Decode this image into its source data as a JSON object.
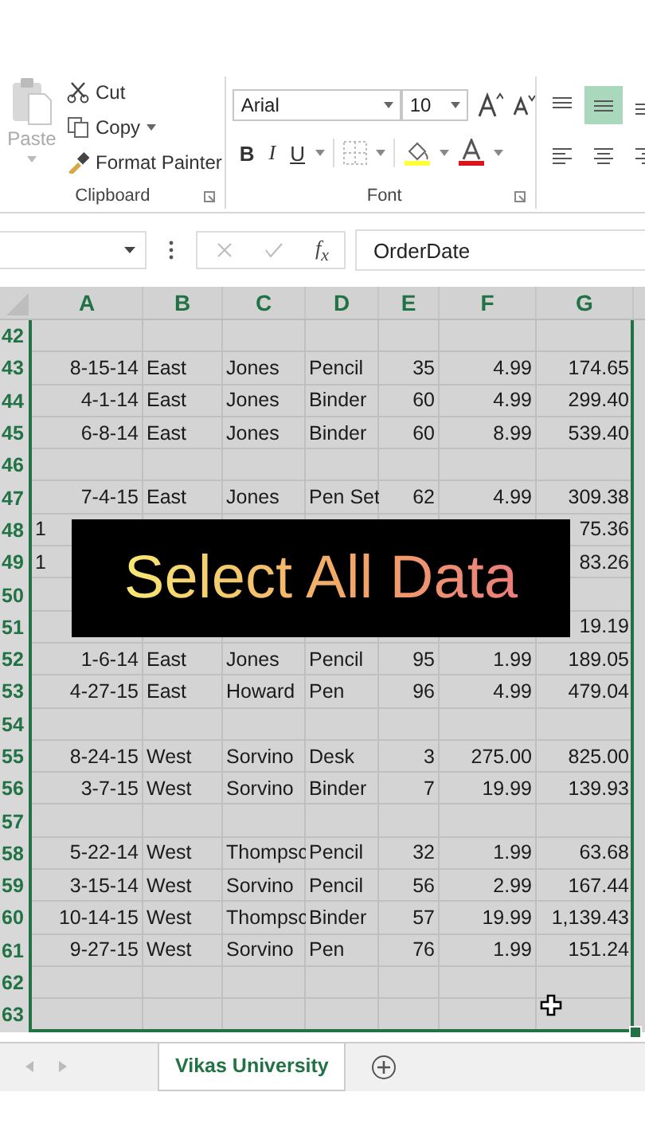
{
  "ribbon": {
    "clipboard": {
      "paste": {
        "label": "Paste",
        "disabled": true
      },
      "cut": "Cut",
      "copy": "Copy",
      "format_painter": "Format Painter",
      "group_label": "Clipboard"
    },
    "font": {
      "font_name": "Arial",
      "font_size": "10",
      "bold": "B",
      "italic": "I",
      "underline": "U",
      "group_label": "Font"
    },
    "alignment": {
      "top_buttons": [
        {
          "kind": "top",
          "selected": false
        },
        {
          "kind": "middle",
          "selected": true
        },
        {
          "kind": "bottom",
          "selected": false
        }
      ],
      "bottom_buttons": [
        {
          "kind": "left",
          "selected": false
        },
        {
          "kind": "center",
          "selected": false
        },
        {
          "kind": "right",
          "selected": false
        }
      ]
    }
  },
  "formula_bar": {
    "function_symbol": "f$_{x}$",
    "formula": "OrderDate"
  },
  "columns": [
    {
      "label": "A",
      "selected": true
    },
    {
      "label": "B",
      "selected": true
    },
    {
      "label": "C",
      "selected": true
    },
    {
      "label": "D",
      "selected": true
    },
    {
      "label": "E",
      "selected": true
    },
    {
      "label": "F",
      "selected": true
    },
    {
      "label": "G",
      "selected": true
    }
  ],
  "rows": [
    {
      "header": "42",
      "selected": true
    },
    {
      "header": "43",
      "selected": true,
      "cells": [
        "8-15-14",
        "East",
        "Jones",
        "Pencil",
        "35",
        "4.99",
        "174.65"
      ]
    },
    {
      "header": "44",
      "selected": true,
      "cells": [
        "4-1-14",
        "East",
        "Jones",
        "Binder",
        "60",
        "4.99",
        "299.40"
      ]
    },
    {
      "header": "45",
      "selected": true,
      "cells": [
        "6-8-14",
        "East",
        "Jones",
        "Binder",
        "60",
        "8.99",
        "539.40"
      ]
    },
    {
      "header": "46",
      "selected": true
    },
    {
      "header": "47",
      "selected": true,
      "cells": [
        "7-4-15",
        "East",
        "Jones",
        "Pen Set",
        "62",
        "4.99",
        "309.38"
      ]
    },
    {
      "header": "48",
      "selected": true,
      "covered": true,
      "cells": [
        "1",
        null,
        null,
        null,
        null,
        null,
        "75.36"
      ]
    },
    {
      "header": "49",
      "selected": true,
      "covered": true,
      "cells": [
        "1",
        null,
        null,
        null,
        null,
        null,
        "83.26"
      ]
    },
    {
      "header": "50",
      "selected": true
    },
    {
      "header": "51",
      "selected": true,
      "cells": [
        null,
        null,
        null,
        null,
        null,
        null,
        "19.19"
      ]
    },
    {
      "header": "52",
      "selected": true,
      "cells": [
        "1-6-14",
        "East",
        "Jones",
        "Pencil",
        "95",
        "1.99",
        "189.05"
      ]
    },
    {
      "header": "53",
      "selected": true,
      "cells": [
        "4-27-15",
        "East",
        "Howard",
        "Pen",
        "96",
        "4.99",
        "479.04"
      ]
    },
    {
      "header": "54",
      "selected": true
    },
    {
      "header": "55",
      "selected": true,
      "cells": [
        "8-24-15",
        "West",
        "Sorvino",
        "Desk",
        "3",
        "275.00",
        "825.00"
      ]
    },
    {
      "header": "56",
      "selected": true,
      "cells": [
        "3-7-15",
        "West",
        "Sorvino",
        "Binder",
        "7",
        "19.99",
        "139.93"
      ]
    },
    {
      "header": "57",
      "selected": true
    },
    {
      "header": "58",
      "selected": true,
      "cells": [
        "5-22-14",
        "West",
        "Thompsc",
        "Pencil",
        "32",
        "1.99",
        "63.68"
      ]
    },
    {
      "header": "59",
      "selected": true,
      "cells": [
        "3-15-14",
        "West",
        "Sorvino",
        "Pencil",
        "56",
        "2.99",
        "167.44"
      ]
    },
    {
      "header": "60",
      "selected": true,
      "cells": [
        "10-14-15",
        "West",
        "Thompsc",
        "Binder",
        "57",
        "19.99",
        "1,139.43"
      ]
    },
    {
      "header": "61",
      "selected": true,
      "cells": [
        "9-27-15",
        "West",
        "Sorvino",
        "Pen",
        "76",
        "1.99",
        "151.24"
      ]
    },
    {
      "header": "62",
      "selected": true
    },
    {
      "header": "63",
      "selected": true
    }
  ],
  "caption": "Select All Data",
  "sheet_tabs": [
    {
      "label": "Vikas University",
      "selected": true
    }
  ]
}
